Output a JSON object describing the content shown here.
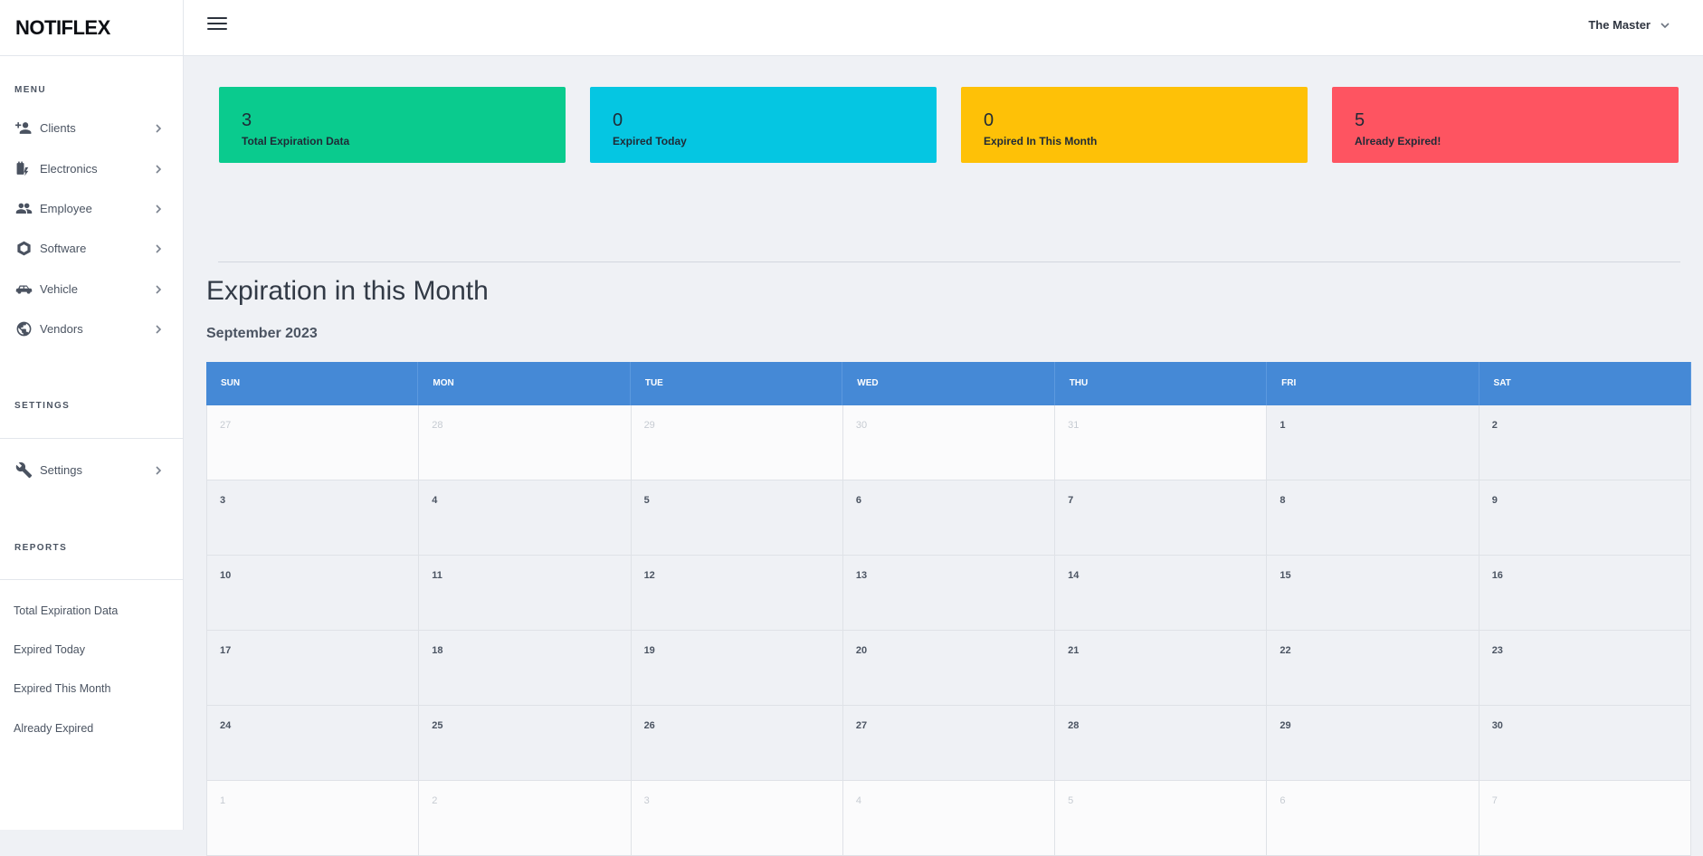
{
  "brand": "NOTIFLEX",
  "sidebar": {
    "menu_title": "MENU",
    "items": [
      {
        "label": "Clients",
        "icon": "person-add-icon"
      },
      {
        "label": "Electronics",
        "icon": "power-plug-icon"
      },
      {
        "label": "Employee",
        "icon": "people-icon"
      },
      {
        "label": "Software",
        "icon": "hexagon-icon"
      },
      {
        "label": "Vehicle",
        "icon": "car-icon"
      },
      {
        "label": "Vendors",
        "icon": "globe-icon"
      }
    ],
    "settings_title": "SETTINGS",
    "settings_item": {
      "label": "Settings",
      "icon": "wrench-icon"
    },
    "reports_title": "REPORTS",
    "reports": [
      "Total Expiration Data",
      "Expired Today",
      "Expired This Month",
      "Already Expired"
    ]
  },
  "topbar": {
    "user": "The Master"
  },
  "cards": [
    {
      "value": "3",
      "caption": "Total Expiration Data",
      "color": "#0acb8e"
    },
    {
      "value": "0",
      "caption": "Expired Today",
      "color": "#05c6e2"
    },
    {
      "value": "0",
      "caption": "Expired In This Month",
      "color": "#fec107"
    },
    {
      "value": "5",
      "caption": "Already Expired!",
      "color": "#fe5461"
    }
  ],
  "heading": "Expiration in this Month",
  "calendar": {
    "month": "September 2023",
    "days": [
      "SUN",
      "MON",
      "TUE",
      "WED",
      "THU",
      "FRI",
      "SAT"
    ],
    "weeks": [
      [
        {
          "d": "27",
          "o": true
        },
        {
          "d": "28",
          "o": true
        },
        {
          "d": "29",
          "o": true
        },
        {
          "d": "30",
          "o": true
        },
        {
          "d": "31",
          "o": true
        },
        {
          "d": "1",
          "o": false
        },
        {
          "d": "2",
          "o": false
        }
      ],
      [
        {
          "d": "3",
          "o": false
        },
        {
          "d": "4",
          "o": false
        },
        {
          "d": "5",
          "o": false
        },
        {
          "d": "6",
          "o": false
        },
        {
          "d": "7",
          "o": false
        },
        {
          "d": "8",
          "o": false
        },
        {
          "d": "9",
          "o": false
        }
      ],
      [
        {
          "d": "10",
          "o": false
        },
        {
          "d": "11",
          "o": false
        },
        {
          "d": "12",
          "o": false
        },
        {
          "d": "13",
          "o": false
        },
        {
          "d": "14",
          "o": false
        },
        {
          "d": "15",
          "o": false
        },
        {
          "d": "16",
          "o": false
        }
      ],
      [
        {
          "d": "17",
          "o": false
        },
        {
          "d": "18",
          "o": false
        },
        {
          "d": "19",
          "o": false
        },
        {
          "d": "20",
          "o": false
        },
        {
          "d": "21",
          "o": false
        },
        {
          "d": "22",
          "o": false
        },
        {
          "d": "23",
          "o": false
        }
      ],
      [
        {
          "d": "24",
          "o": false
        },
        {
          "d": "25",
          "o": false
        },
        {
          "d": "26",
          "o": false
        },
        {
          "d": "27",
          "o": false
        },
        {
          "d": "28",
          "o": false
        },
        {
          "d": "29",
          "o": false
        },
        {
          "d": "30",
          "o": false
        }
      ],
      [
        {
          "d": "1",
          "o": true
        },
        {
          "d": "2",
          "o": true
        },
        {
          "d": "3",
          "o": true
        },
        {
          "d": "4",
          "o": true
        },
        {
          "d": "5",
          "o": true
        },
        {
          "d": "6",
          "o": true
        },
        {
          "d": "7",
          "o": true
        }
      ]
    ]
  }
}
